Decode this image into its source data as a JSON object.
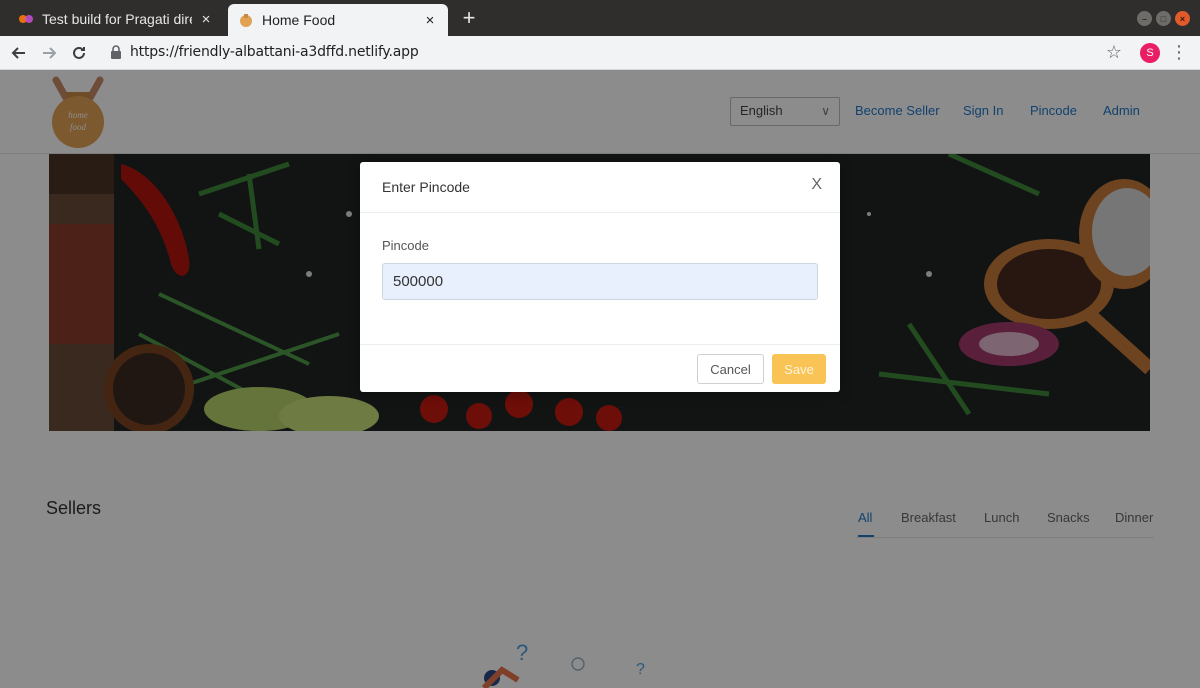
{
  "browser": {
    "tabs": [
      {
        "title": "Test build for Pragati dire",
        "close": "×"
      },
      {
        "title": "Home Food",
        "close": "×"
      }
    ],
    "new_tab": "+",
    "url": "https://friendly-albattani-a3dffd.netlify.app",
    "profile_initial": "S"
  },
  "header": {
    "logo_text": "Home Food",
    "language": "English",
    "nav": [
      "Become Seller",
      "Sign In",
      "Pincode",
      "Admin"
    ],
    "colors": {
      "link": "#1f78c8"
    }
  },
  "sellers": {
    "title": "Sellers",
    "tabs": [
      "All",
      "Breakfast",
      "Lunch",
      "Snacks",
      "Dinner"
    ],
    "active_tab": "All"
  },
  "modal": {
    "title": "Enter Pincode",
    "close_label": "X",
    "field_label": "Pincode",
    "field_value": "500000",
    "cancel_label": "Cancel",
    "save_label": "Save",
    "colors": {
      "save": "#f9c455",
      "input_bg": "#e8effd"
    }
  }
}
